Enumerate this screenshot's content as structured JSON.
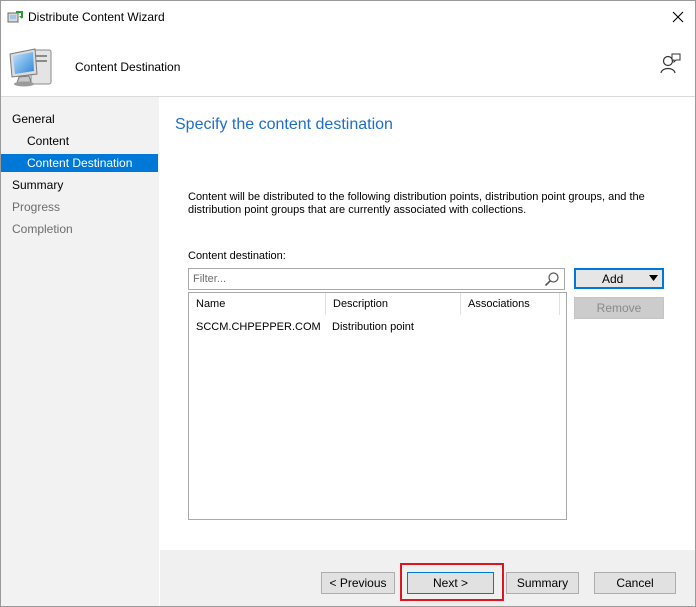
{
  "window": {
    "title": "Distribute Content Wizard",
    "icons": {
      "app": "distribute-content-icon",
      "close": "close-icon"
    }
  },
  "header": {
    "page_title": "Content Destination",
    "icons": {
      "banner": "computer-monitor-icon",
      "help": "help-person-icon"
    }
  },
  "nav": {
    "items": [
      {
        "label": "General",
        "level": 0,
        "state": "normal"
      },
      {
        "label": "Content",
        "level": 1,
        "state": "normal"
      },
      {
        "label": "Content Destination",
        "level": 1,
        "state": "active"
      },
      {
        "label": "Summary",
        "level": 0,
        "state": "normal"
      },
      {
        "label": "Progress",
        "level": 0,
        "state": "disabled"
      },
      {
        "label": "Completion",
        "level": 0,
        "state": "disabled"
      }
    ]
  },
  "main": {
    "heading": "Specify the content destination",
    "description": "Content will be distributed to the following distribution points, distribution point groups, and the distribution point groups that are currently associated with collections.",
    "destination_label": "Content destination:",
    "filter": {
      "placeholder": "Filter...",
      "value": "",
      "icon": "search-icon"
    },
    "table": {
      "columns": [
        "Name",
        "Description",
        "Associations"
      ],
      "rows": [
        {
          "name": "SCCM.CHPEPPER.COM",
          "description": "Distribution point",
          "associations": ""
        }
      ]
    },
    "add_label": "Add",
    "add_icon": "dropdown-arrow-icon",
    "remove_label": "Remove"
  },
  "footer": {
    "previous_label": "< Previous",
    "next_label": "Next >",
    "summary_label": "Summary",
    "cancel_label": "Cancel"
  },
  "colors": {
    "accent": "#0078d7",
    "heading": "#1e6ec8",
    "highlight": "#e0141e",
    "nav_background": "#f2f2f2",
    "footer_background": "#f0f0f0"
  }
}
